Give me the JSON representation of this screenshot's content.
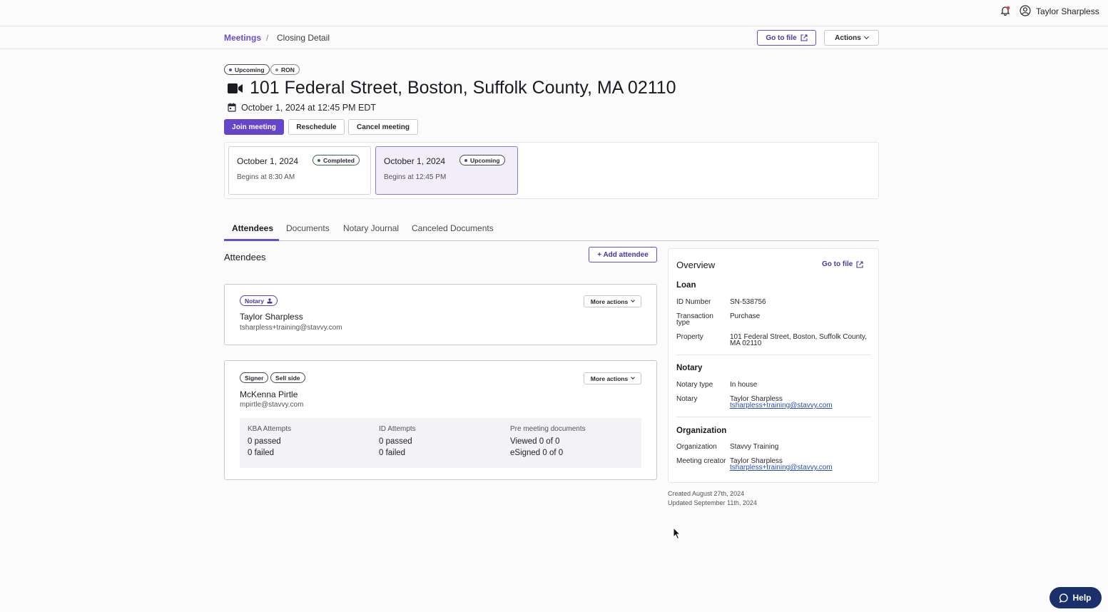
{
  "header": {
    "user_name": "Taylor Sharpless",
    "colors": {
      "accent": "#6546c9",
      "link": "#2a4fae",
      "help_bg": "#1b2f6b",
      "notification_dot": "#e0423a"
    }
  },
  "breadcrumb": {
    "root": "Meetings",
    "separator": "/",
    "current": "Closing Detail"
  },
  "toolbar": {
    "go_to_file": "Go to file",
    "actions": "Actions"
  },
  "meeting": {
    "status_badge": "Upcoming",
    "type_badge": "RON",
    "title": "101 Federal Street, Boston, Suffolk County, MA 02110",
    "datetime": "October 1, 2024 at 12:45 PM EDT",
    "buttons": {
      "join": "Join meeting",
      "reschedule": "Reschedule",
      "cancel": "Cancel meeting"
    },
    "sessions": [
      {
        "date": "October 1, 2024",
        "status": "Completed",
        "begins": "Begins at 8:30 AM"
      },
      {
        "date": "October 1, 2024",
        "status": "Upcoming",
        "begins": "Begins at 12:45 PM"
      }
    ]
  },
  "tabs": [
    "Attendees",
    "Documents",
    "Notary Journal",
    "Canceled Documents"
  ],
  "attendees": {
    "title": "Attendees",
    "add_button": "+ Add attendee",
    "more_actions": "More actions",
    "notary": {
      "role": "Notary",
      "name": "Taylor Sharpless",
      "email": "tsharpless+training@stavvy.com"
    },
    "signer": {
      "roles": [
        "Signer",
        "Sell side"
      ],
      "name": "McKenna Pirtle",
      "email": "mpirtle@stavvy.com",
      "stats": [
        {
          "label": "KBA Attempts",
          "line1": "0 passed",
          "line2": "0 failed"
        },
        {
          "label": "ID Attempts",
          "line1": "0 passed",
          "line2": "0 failed"
        },
        {
          "label": "Pre meeting documents",
          "line1": "Viewed 0 of 0",
          "line2": "eSigned 0 of 0"
        }
      ]
    }
  },
  "overview": {
    "title": "Overview",
    "go_to_file": "Go to file",
    "loan": {
      "heading": "Loan",
      "id_label": "ID Number",
      "id_value": "SN-538756",
      "type_label": "Transaction type",
      "type_value": "Purchase",
      "property_label": "Property",
      "property_value": "101 Federal Street, Boston, Suffolk County, MA 02110"
    },
    "notary": {
      "heading": "Notary",
      "type_label": "Notary type",
      "type_value": "In house",
      "notary_label": "Notary",
      "notary_name": "Taylor Sharpless",
      "notary_email": "tsharpless+training@stavvy.com"
    },
    "organization": {
      "heading": "Organization",
      "org_label": "Organization",
      "org_value": "Stavvy Training",
      "creator_label": "Meeting creator",
      "creator_name": "Taylor Sharpless",
      "creator_email": "tsharpless+training@stavvy.com"
    },
    "created": "Created August 27th, 2024",
    "updated": "Updated September 11th, 2024"
  },
  "help": {
    "label": "Help"
  }
}
